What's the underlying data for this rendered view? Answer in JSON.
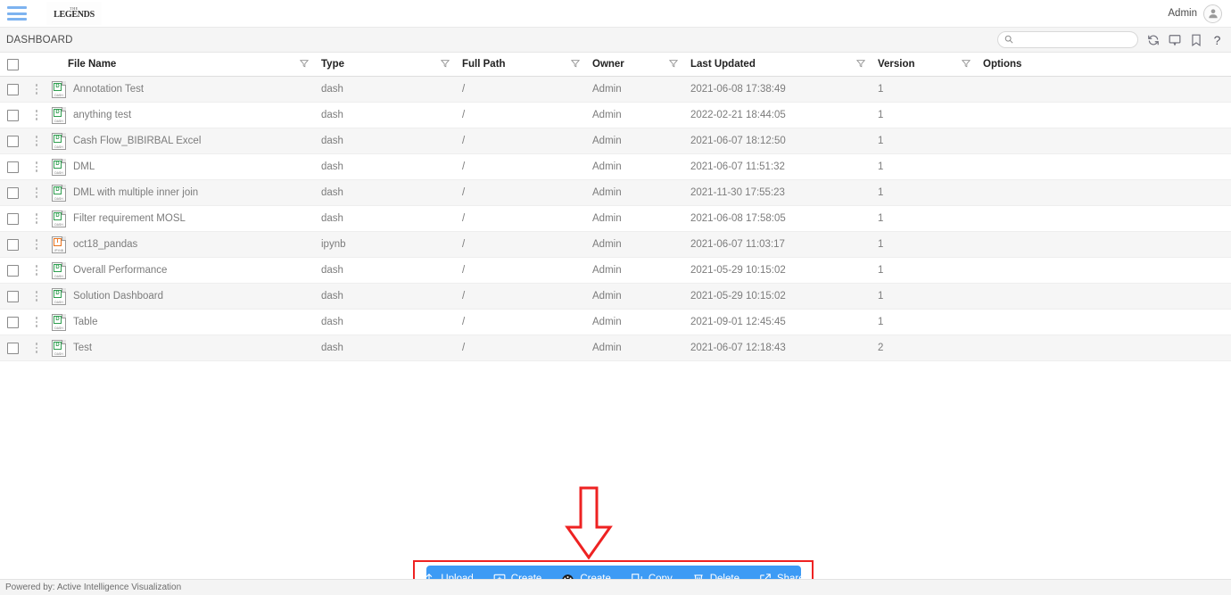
{
  "topbar": {
    "menu_icon": "hamburger-menu-icon",
    "logo_top": "THE",
    "logo_main": "LEGENDS",
    "user_label": "Admin",
    "avatar_icon": "user-avatar-icon"
  },
  "strip": {
    "breadcrumb": "DASHBOARD",
    "search_placeholder": "",
    "search_value": "",
    "search_icon": "search-icon",
    "icons": [
      {
        "name": "refresh-icon",
        "title": "Refresh"
      },
      {
        "name": "comment-icon",
        "title": "Comments"
      },
      {
        "name": "bookmark-icon",
        "title": "Bookmark"
      },
      {
        "name": "help-icon",
        "title": "Help",
        "glyph": "?"
      }
    ]
  },
  "table": {
    "columns": [
      {
        "key": "name",
        "label": "File Name",
        "filter": true
      },
      {
        "key": "type",
        "label": "Type",
        "filter": true
      },
      {
        "key": "path",
        "label": "Full Path",
        "filter": true
      },
      {
        "key": "owner",
        "label": "Owner",
        "filter": true
      },
      {
        "key": "updated",
        "label": "Last Updated",
        "filter": true
      },
      {
        "key": "version",
        "label": "Version",
        "filter": true
      },
      {
        "key": "options",
        "label": "Options",
        "filter": false
      }
    ],
    "rows": [
      {
        "name": "Annotation Test",
        "type": "dash",
        "path": "/",
        "owner": "Admin",
        "updated": "2021-06-08 17:38:49",
        "version": "1",
        "icon": "dash-file-icon"
      },
      {
        "name": "anything test",
        "type": "dash",
        "path": "/",
        "owner": "Admin",
        "updated": "2022-02-21 18:44:05",
        "version": "1",
        "icon": "dash-file-icon"
      },
      {
        "name": "Cash Flow_BIBIRBAL Excel",
        "type": "dash",
        "path": "/",
        "owner": "Admin",
        "updated": "2021-06-07 18:12:50",
        "version": "1",
        "icon": "dash-file-icon"
      },
      {
        "name": "DML",
        "type": "dash",
        "path": "/",
        "owner": "Admin",
        "updated": "2021-06-07 11:51:32",
        "version": "1",
        "icon": "dash-file-icon"
      },
      {
        "name": "DML with multiple inner join",
        "type": "dash",
        "path": "/",
        "owner": "Admin",
        "updated": "2021-11-30 17:55:23",
        "version": "1",
        "icon": "dash-file-icon"
      },
      {
        "name": "Filter requirement MOSL",
        "type": "dash",
        "path": "/",
        "owner": "Admin",
        "updated": "2021-06-08 17:58:05",
        "version": "1",
        "icon": "dash-file-icon"
      },
      {
        "name": "oct18_pandas",
        "type": "ipynb",
        "path": "/",
        "owner": "Admin",
        "updated": "2021-06-07 11:03:17",
        "version": "1",
        "icon": "ipynb-file-icon"
      },
      {
        "name": "Overall Performance",
        "type": "dash",
        "path": "/",
        "owner": "Admin",
        "updated": "2021-05-29 10:15:02",
        "version": "1",
        "icon": "dash-file-icon"
      },
      {
        "name": "Solution Dashboard",
        "type": "dash",
        "path": "/",
        "owner": "Admin",
        "updated": "2021-05-29 10:15:02",
        "version": "1",
        "icon": "dash-file-icon"
      },
      {
        "name": "Table",
        "type": "dash",
        "path": "/",
        "owner": "Admin",
        "updated": "2021-09-01 12:45:45",
        "version": "1",
        "icon": "dash-file-icon"
      },
      {
        "name": "Test",
        "type": "dash",
        "path": "/",
        "owner": "Admin",
        "updated": "2021-06-07 12:18:43",
        "version": "2",
        "icon": "dash-file-icon"
      }
    ],
    "file_ext_labels": {
      "dash": "DASH",
      "ipynb": "IPYNB"
    }
  },
  "actionbar": {
    "items": [
      {
        "label": "Upload",
        "icon": "upload-icon"
      },
      {
        "label": "Create",
        "icon": "create-folder-icon"
      },
      {
        "label": "Create",
        "icon": "create-dashboard-icon"
      },
      {
        "label": "Copy",
        "icon": "copy-icon"
      },
      {
        "label": "Delete",
        "icon": "delete-trash-icon"
      },
      {
        "label": "Share",
        "icon": "share-icon"
      }
    ]
  },
  "annotation": {
    "shape": "red-down-arrow",
    "color": "#ee2222"
  },
  "footer": {
    "text": "Powered by: Active Intelligence Visualization"
  },
  "colors": {
    "accent_blue": "#3d9bf5",
    "menu_blue": "#7db3f0",
    "annotation_red": "#ee2222",
    "dash_green": "#2e9e4f",
    "ipynb_orange": "#e8711a",
    "strip_bg": "#f5f5f5",
    "row_alt_bg": "#f6f6f6"
  }
}
